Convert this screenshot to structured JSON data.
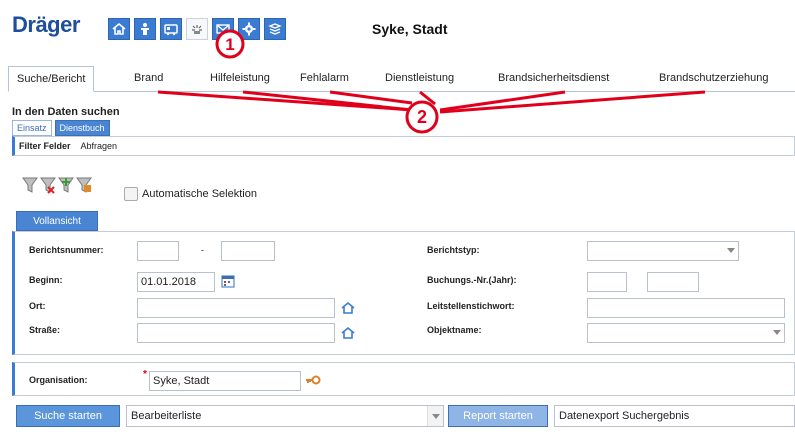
{
  "header": {
    "logo": "Dräger",
    "location_title": "Syke, Stadt",
    "nav_icons": [
      "home-icon",
      "person-icon",
      "vehicle-icon",
      "alarm-icon",
      "mail-icon",
      "gear-icon",
      "layers-icon"
    ]
  },
  "tabs": [
    "Suche/Bericht",
    "Brand",
    "Hilfeleistung",
    "Fehlalarm",
    "Dienstleistung",
    "Brandsicherheitsdienst",
    "Brandschutzerziehung"
  ],
  "annotations": {
    "marker_1": "1",
    "marker_2": "2"
  },
  "search": {
    "title": "In den Daten suchen",
    "subtabs": [
      "Einsatz",
      "Dienstbuch"
    ],
    "filter_fields": "Filter Felder",
    "queries": "Abfragen",
    "auto_selection": "Automatische Selektion",
    "full_view": "Vollansicht"
  },
  "form": {
    "report_number_label": "Berichtsnummer:",
    "range_dash": "-",
    "start_label": "Beginn:",
    "start_value": "01.01.2018",
    "place_label": "Ort:",
    "street_label": "Straße:",
    "report_type_label": "Berichtstyp:",
    "booking_label": "Buchungs.-Nr.(Jahr):",
    "dispatch_keyword_label": "Leitstellenstichwort:",
    "object_name_label": "Objektname:"
  },
  "organisation": {
    "label": "Organisation:",
    "required_mark": "*",
    "value": "Syke, Stadt"
  },
  "actions": {
    "start_search": "Suche starten",
    "editor_list": "Bearbeiterliste",
    "start_report": "Report starten",
    "data_export": "Datenexport Suchergebnis"
  },
  "colors": {
    "brand_blue": "#1f4e9c",
    "button_blue": "#4a85d3",
    "annotation_red": "#e0001b"
  }
}
